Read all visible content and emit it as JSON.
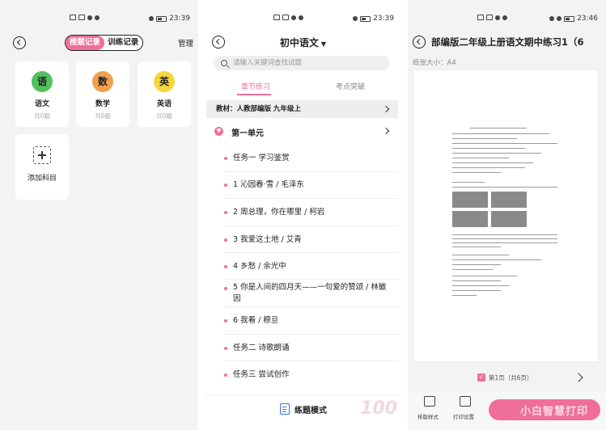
{
  "colors": {
    "accent": "#ef6f99",
    "chinese": "#52c15e",
    "math": "#f2a04d",
    "english": "#f5d63d",
    "mode_icon": "#3a6fd8"
  },
  "status_bars": [
    {
      "time": "23:39"
    },
    {
      "time": "23:39"
    },
    {
      "time": "23:46"
    }
  ],
  "panel1": {
    "tabs": [
      "搜题记录",
      "训练记录"
    ],
    "manage_label": "管理",
    "subjects": [
      {
        "badge": "语",
        "name": "语文",
        "count": "共0题"
      },
      {
        "badge": "数",
        "name": "数学",
        "count": "共0题"
      },
      {
        "badge": "英",
        "name": "英语",
        "count": "共0题"
      }
    ],
    "add_subject_label": "添加科目"
  },
  "panel2": {
    "title": "初中语文",
    "search_placeholder": "请输入关键词查找试题",
    "tabs": [
      "章节练习",
      "考点突破"
    ],
    "textbook_label": "教材：人教部编版 九年级上",
    "unit_label": "第一单元",
    "lessons": [
      "任务一 学习鉴赏",
      "1 沁园春·雪 / 毛泽东",
      "2 周总理，你在哪里 / 柯岩",
      "3 我爱这土地 / 艾青",
      "4 乡愁 / 余光中",
      "5 你是人间的四月天——一句爱的赞颂 / 林徽因",
      "6 我看 / 穆旦",
      "任务二 诗歌朗诵",
      "任务三 尝试创作"
    ],
    "mode_label": "练题模式",
    "watermark": "100"
  },
  "panel3": {
    "title": "部编版二年级上册语文期中练习1（6",
    "paper_size": "纸张大小：A4",
    "page_label": "第1页（共6页）",
    "tools": [
      "排版样式",
      "打印设置"
    ],
    "watermark_text": "小白智慧打印"
  }
}
